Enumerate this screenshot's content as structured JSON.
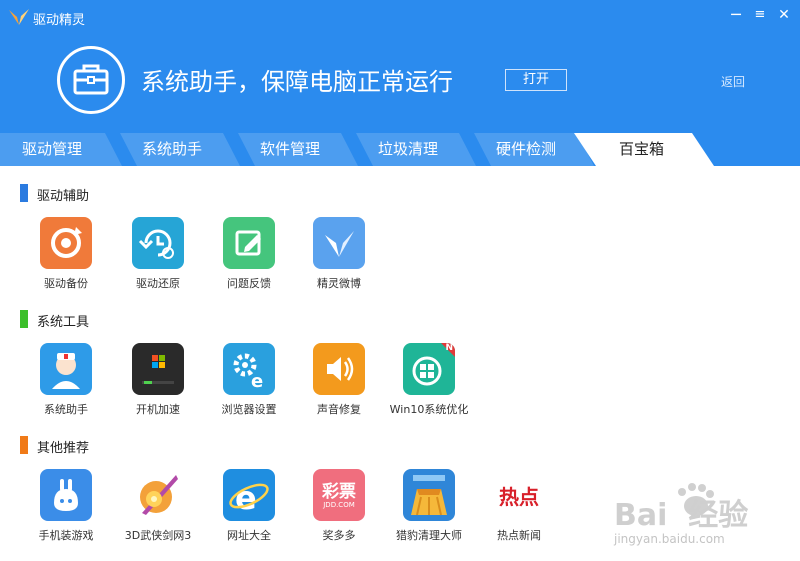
{
  "app": {
    "title": "驱动精灵"
  },
  "window": {
    "minimize": "─",
    "close": "✕"
  },
  "hero": {
    "title": "系统助手，保障电脑正常运行",
    "open_label": "打开",
    "back_label": "返回"
  },
  "tabs": [
    {
      "label": "驱动管理"
    },
    {
      "label": "系统助手"
    },
    {
      "label": "软件管理"
    },
    {
      "label": "垃圾清理"
    },
    {
      "label": "硬件检测"
    },
    {
      "label": "百宝箱",
      "active": true
    }
  ],
  "sections": [
    {
      "title": "驱动辅助",
      "color": "#2b7be0",
      "items": [
        {
          "label": "驱动备份",
          "icon": "backup-icon"
        },
        {
          "label": "驱动还原",
          "icon": "restore-icon"
        },
        {
          "label": "问题反馈",
          "icon": "feedback-icon"
        },
        {
          "label": "精灵微博",
          "icon": "weibo-icon"
        }
      ]
    },
    {
      "title": "系统工具",
      "color": "#3cbf2a",
      "items": [
        {
          "label": "系统助手",
          "icon": "doctor-icon"
        },
        {
          "label": "开机加速",
          "icon": "boot-speed-icon"
        },
        {
          "label": "浏览器设置",
          "icon": "browser-settings-icon"
        },
        {
          "label": "声音修复",
          "icon": "sound-repair-icon"
        },
        {
          "label": "Win10系统优化",
          "icon": "win10-optimize-icon",
          "badge": "N"
        }
      ]
    },
    {
      "title": "其他推荐",
      "color": "#f07a18",
      "items": [
        {
          "label": "手机装游戏",
          "icon": "mobile-game-icon"
        },
        {
          "label": "3D武侠剑网3",
          "icon": "jx3-icon"
        },
        {
          "label": "网址大全",
          "icon": "ie-icon"
        },
        {
          "label": "奖多多",
          "icon": "lottery-icon",
          "icon_text": [
            "彩票",
            "JDD.COM"
          ]
        },
        {
          "label": "猎豹清理大师",
          "icon": "broom-icon"
        },
        {
          "label": "热点新闻",
          "icon": "hot-news-icon",
          "icon_text": "热点"
        }
      ]
    }
  ],
  "watermark": {
    "brand": "Bai  经验",
    "url": "jingyan.baidu.com"
  },
  "colors": {
    "header": "#2b8bee",
    "tab_inactive": "#4c9df0",
    "tab_active": "#ffffff"
  }
}
